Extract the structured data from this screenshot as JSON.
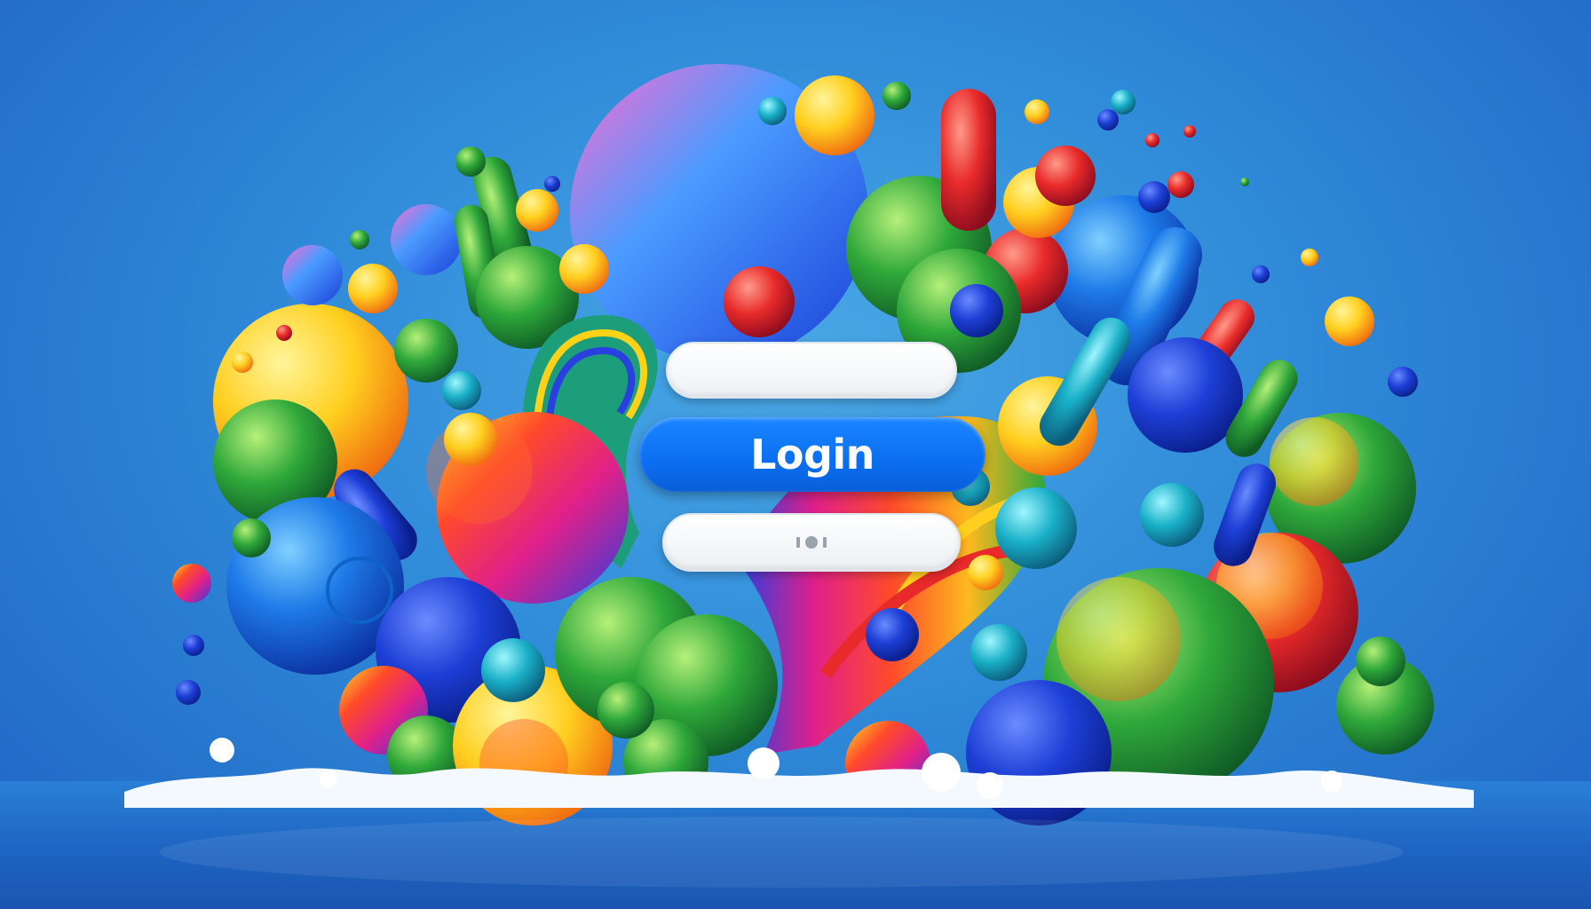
{
  "login_form": {
    "login_label": "Login",
    "top_field_value": "",
    "bottom_field_icon": "toggle-dots-icon"
  },
  "colors": {
    "background": "#2f8ad8",
    "button": "#0b6ef0",
    "button_text": "#ffffff",
    "field": "#f2f4f7"
  }
}
